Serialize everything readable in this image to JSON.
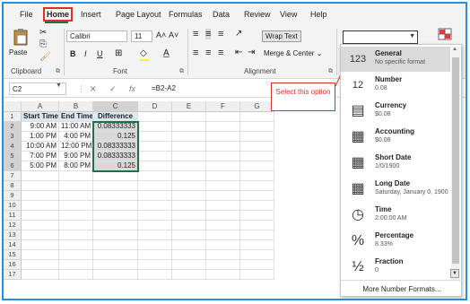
{
  "menu": {
    "file": "File",
    "home": "Home",
    "insert": "Insert",
    "page_layout": "Page Layout",
    "formulas": "Formulas",
    "data": "Data",
    "review": "Review",
    "view": "View",
    "help": "Help"
  },
  "ribbon": {
    "clipboard": {
      "label": "Clipboard",
      "paste": "Paste",
      "paste_icon": "clipboard-icon"
    },
    "font": {
      "label": "Font",
      "family": "Calibri",
      "size": "11",
      "grow": "A˄",
      "shrink": "A˅",
      "bold": "B",
      "italic": "I",
      "underline": "U"
    },
    "alignment": {
      "label": "Alignment",
      "wrap_text": "Wrap Text",
      "merge_center": "Merge & Center"
    },
    "number": {
      "combo_value": ""
    }
  },
  "formula_bar": {
    "name_box": "C2",
    "cancel": "✕",
    "enter": "✓",
    "fx": "fx",
    "formula": "=B2-A2"
  },
  "sheet": {
    "columns": [
      "A",
      "B",
      "C",
      "D",
      "E",
      "F",
      "G"
    ],
    "rows": [
      "1",
      "2",
      "3",
      "4",
      "5",
      "6",
      "7",
      "8",
      "9",
      "10",
      "11",
      "12",
      "13",
      "14",
      "15",
      "16",
      "17"
    ],
    "headers": [
      "Start Time",
      "End Time",
      "Difference"
    ],
    "data": [
      [
        "9:00 AM",
        "11:00 AM",
        "0.08333333"
      ],
      [
        "1:00 PM",
        "4:00 PM",
        "0.125"
      ],
      [
        "10:00 AM",
        "12:00 PM",
        "0.08333333"
      ],
      [
        "7:00 PM",
        "9:00 PM",
        "0.08333333"
      ],
      [
        "5:00 PM",
        "8:00 PM",
        "0.125"
      ]
    ]
  },
  "callout": {
    "text": "Select this option"
  },
  "dropdown": {
    "items": [
      {
        "name": "General",
        "sample": "No specific format",
        "icon": "clock-123-icon",
        "glyph": "123",
        "active": true
      },
      {
        "name": "Number",
        "sample": "0.08",
        "icon": "number-12-icon",
        "glyph": "12"
      },
      {
        "name": "Currency",
        "sample": "$0.08",
        "icon": "currency-icon",
        "glyph": "▤"
      },
      {
        "name": "Accounting",
        "sample": "$0.08",
        "icon": "accounting-icon",
        "glyph": "▦"
      },
      {
        "name": "Short Date",
        "sample": "1/0/1900",
        "icon": "calendar-icon",
        "glyph": "▦"
      },
      {
        "name": "Long Date",
        "sample": "Saturday, January 0, 1900",
        "icon": "calendar-long-icon",
        "glyph": "▦"
      },
      {
        "name": "Time",
        "sample": "2:00:00 AM",
        "icon": "clock-icon",
        "glyph": "◷"
      },
      {
        "name": "Percentage",
        "sample": "8.33%",
        "icon": "percent-icon",
        "glyph": "%"
      },
      {
        "name": "Fraction",
        "sample": "0",
        "icon": "fraction-icon",
        "glyph": "½"
      }
    ],
    "more": "More Number Formats..."
  },
  "colors": {
    "accent_green": "#1e7145",
    "highlight_red": "#d8312a",
    "frame_blue": "#2e8bd8"
  }
}
